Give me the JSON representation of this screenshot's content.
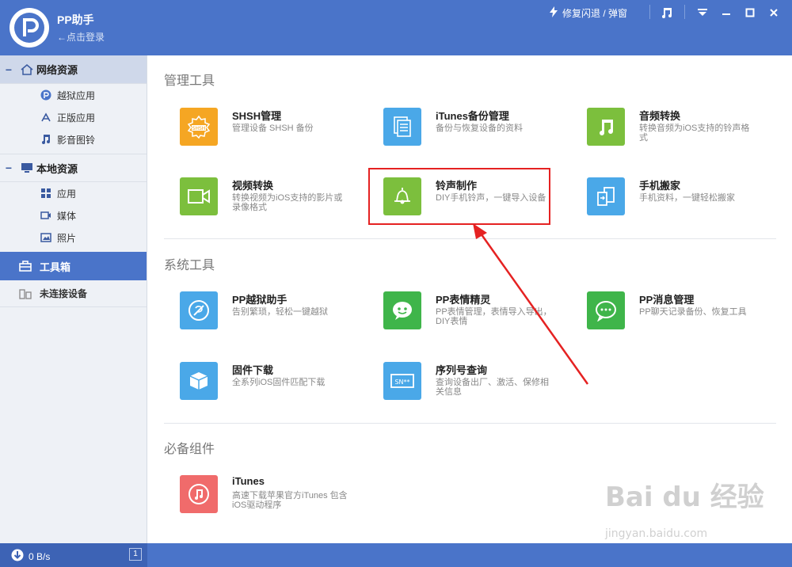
{
  "header": {
    "app_title": "PP助手",
    "login_link": "←点击登录",
    "fix_label": "修复闪退 / 弹窗"
  },
  "sidebar": {
    "groups": [
      {
        "label": "网络资源",
        "items": [
          "越狱应用",
          "正版应用",
          "影音图铃"
        ]
      },
      {
        "label": "本地资源",
        "items": [
          "应用",
          "媒体",
          "照片"
        ]
      }
    ],
    "toolbox": "工具箱",
    "device": "未连接设备"
  },
  "footer": {
    "speed": "0 B/s",
    "badge": "1"
  },
  "sections": [
    {
      "title": "管理工具",
      "tools": [
        {
          "name": "SHSH管理",
          "desc": "管理设备 SHSH 备份",
          "icon": "shsh-icon",
          "color": "#f5a623"
        },
        {
          "name": "iTunes备份管理",
          "desc": "备份与恢复设备的资料",
          "icon": "backup-icon",
          "color": "#4aa8e8"
        },
        {
          "name": "音频转换",
          "desc": "转换音频为iOS支持的铃声格式",
          "icon": "music-note-icon",
          "color": "#7cbf3d"
        },
        {
          "name": "视频转换",
          "desc": "转换视频为iOS支持的影片或录像格式",
          "icon": "video-camera-icon",
          "color": "#7cbf3d"
        },
        {
          "name": "铃声制作",
          "desc": "DIY手机铃声，一键导入设备",
          "icon": "bell-icon",
          "color": "#7cbf3d"
        },
        {
          "name": "手机搬家",
          "desc": "手机资料，一键轻松搬家",
          "icon": "phone-transfer-icon",
          "color": "#4aa8e8"
        }
      ]
    },
    {
      "title": "系统工具",
      "tools": [
        {
          "name": "PP越狱助手",
          "desc": "告别繁琐，轻松一键越狱",
          "icon": "jailbreak-icon",
          "color": "#4aa8e8"
        },
        {
          "name": "PP表情精灵",
          "desc": "PP表情管理，表情导入导出，DIY表情",
          "icon": "emoji-icon",
          "color": "#3fb54a"
        },
        {
          "name": "PP消息管理",
          "desc": "PP聊天记录备份、恢复工具",
          "icon": "chat-icon",
          "color": "#3fb54a"
        },
        {
          "name": "固件下载",
          "desc": "全系列iOS固件匹配下载",
          "icon": "box-icon",
          "color": "#4aa8e8"
        },
        {
          "name": "序列号查询",
          "desc": "查询设备出厂、激活、保修相关信息",
          "icon": "serial-number-icon",
          "color": "#4aa8e8"
        }
      ]
    },
    {
      "title": "必备组件",
      "tools": [
        {
          "name": "iTunes",
          "desc": "高速下载苹果官方iTunes 包含iOS驱动程序",
          "icon": "itunes-icon",
          "color": "#f06b6b"
        }
      ]
    }
  ],
  "watermark": {
    "main": "Bai du 经验",
    "sub": "jingyan.baidu.com"
  }
}
